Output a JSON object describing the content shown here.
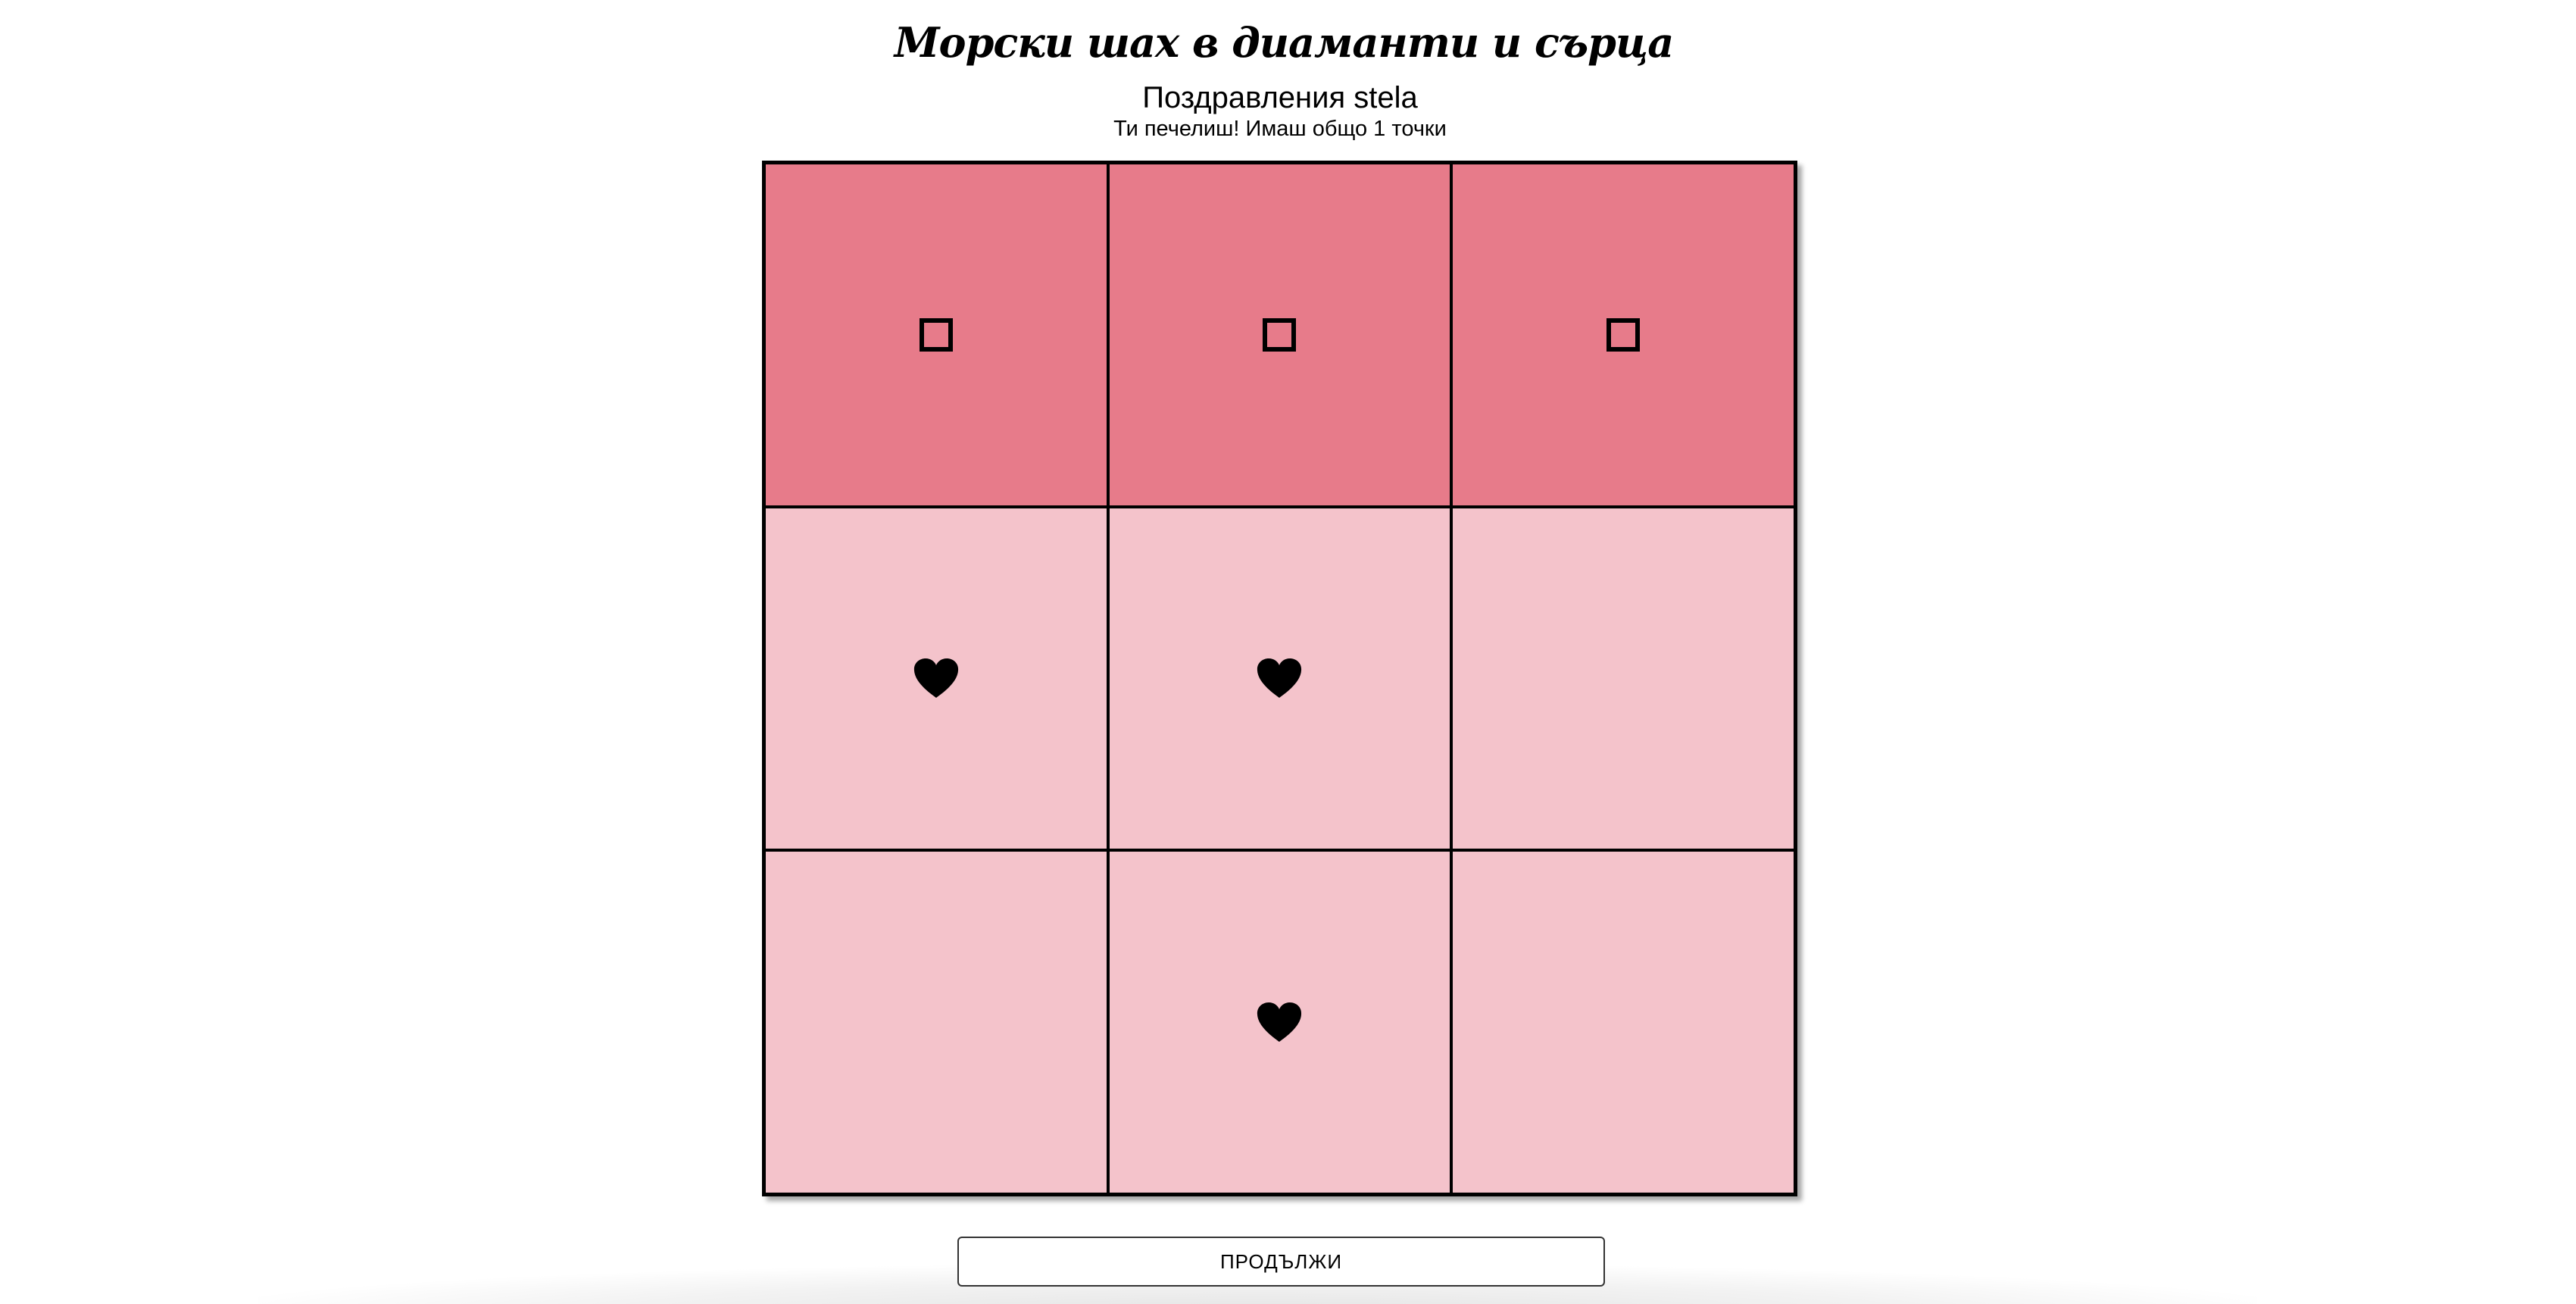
{
  "header": {
    "title": "Морски шах в диаманти и сърца"
  },
  "result": {
    "congrats": "Поздравления stela",
    "score_text": "Ти печелиш! Имаш общо 1 точки"
  },
  "board": {
    "winning_row": 0,
    "colors": {
      "cell": "#f4c3cb",
      "winning_cell": "#e77b8a",
      "border": "#000000"
    },
    "cells": [
      {
        "symbol": "diamond-icon",
        "winning": true
      },
      {
        "symbol": "diamond-icon",
        "winning": true
      },
      {
        "symbol": "diamond-icon",
        "winning": true
      },
      {
        "symbol": "heart-icon",
        "winning": false
      },
      {
        "symbol": "heart-icon",
        "winning": false
      },
      {
        "symbol": "",
        "winning": false
      },
      {
        "symbol": "",
        "winning": false
      },
      {
        "symbol": "heart-icon",
        "winning": false
      },
      {
        "symbol": "",
        "winning": false
      }
    ]
  },
  "actions": {
    "continue_label": "ПРОДЪЛЖИ"
  }
}
